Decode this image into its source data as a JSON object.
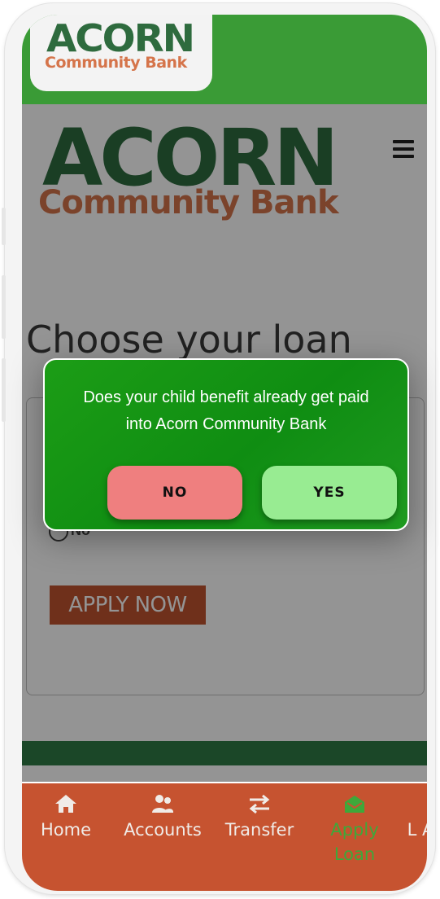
{
  "header": {
    "small_logo_word": "ACORN",
    "small_logo_sub": "Community Bank"
  },
  "page": {
    "logo_word": "ACORN",
    "logo_sub": "Community Bank",
    "title": "Choose your loan",
    "radio_label": "No",
    "apply_label": "APPLY NOW"
  },
  "modal": {
    "question": "Does your child benefit already get paid into Acorn Community Bank",
    "no_label": "NO",
    "yes_label": "YES"
  },
  "nav": {
    "items": [
      {
        "label": "Home",
        "icon": "home-icon"
      },
      {
        "label": "Accounts",
        "icon": "users-icon"
      },
      {
        "label": "Transfer",
        "icon": "transfer-icon"
      },
      {
        "label": "Apply Loan",
        "icon": "envelope-open-icon"
      },
      {
        "label": "L A",
        "icon": ""
      }
    ]
  },
  "colors": {
    "brand_green": "#2e6b3e",
    "brand_orange": "#d5744a",
    "nav_bg": "#c65330",
    "modal_green": "#129314",
    "no_button": "#ef7f7f",
    "yes_button": "#98ec92"
  }
}
